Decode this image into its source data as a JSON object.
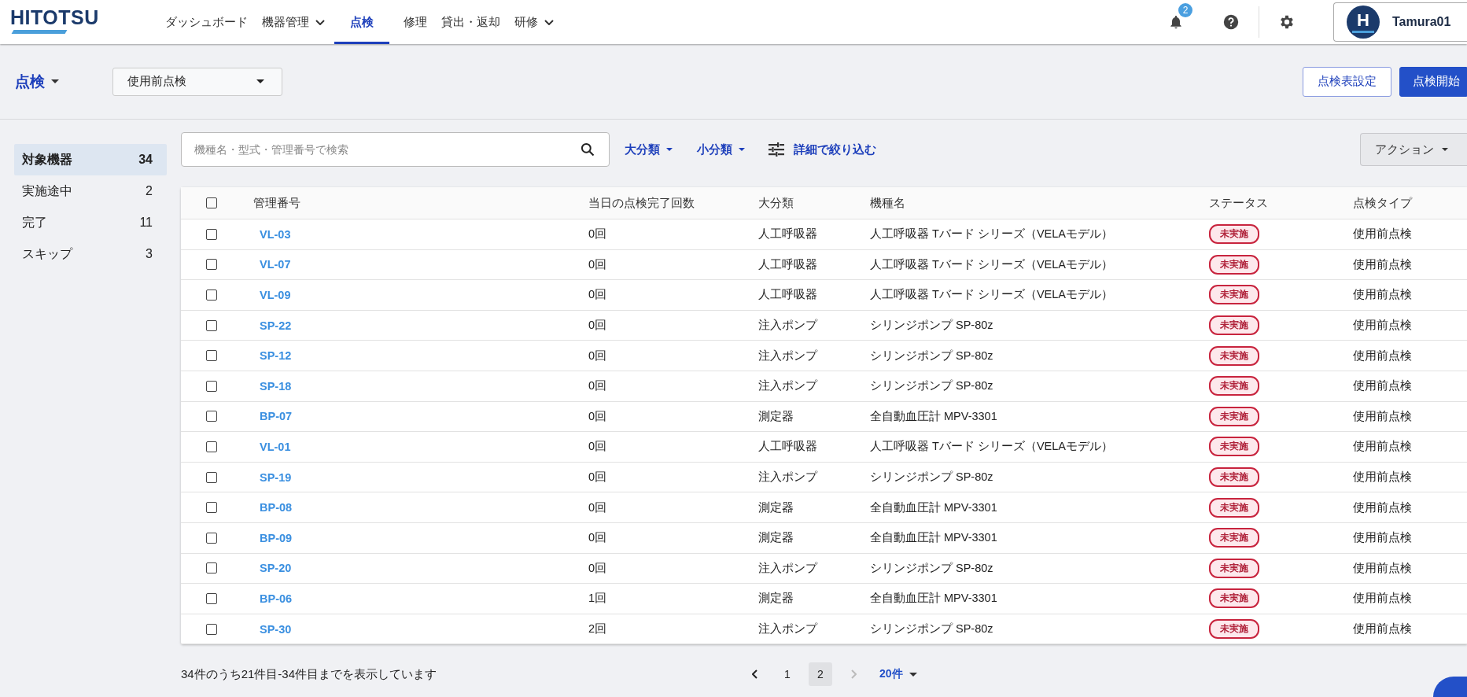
{
  "header": {
    "logo": "HITOTSU",
    "nav": [
      {
        "label": "ダッシュボード",
        "selected": false,
        "dropdown": false
      },
      {
        "label": "機器管理",
        "selected": false,
        "dropdown": true
      },
      {
        "label": "点検",
        "selected": true,
        "dropdown": false
      },
      {
        "label": "修理",
        "selected": false,
        "dropdown": false
      },
      {
        "label": "貸出・返却",
        "selected": false,
        "dropdown": false
      },
      {
        "label": "研修",
        "selected": false,
        "dropdown": true
      }
    ],
    "notification_count": "2",
    "user": {
      "avatar_letter": "H",
      "name": "Tamura01"
    }
  },
  "toolbar": {
    "title": "点検",
    "inspection_select": {
      "value": "使用前点検"
    },
    "buttons": [
      {
        "label": "点検表設定",
        "kind": "outline"
      },
      {
        "label": "点検開始",
        "kind": "primary"
      }
    ]
  },
  "sidebar": {
    "items": [
      {
        "label": "対象機器",
        "count": "34",
        "selected": true
      },
      {
        "label": "実施途中",
        "count": "2",
        "selected": false
      },
      {
        "label": "完了",
        "count": "11",
        "selected": false
      },
      {
        "label": "スキップ",
        "count": "3",
        "selected": false
      }
    ]
  },
  "filters": {
    "search": {
      "placeholder": "機種名・型式・管理番号で検索"
    },
    "dropdowns": [
      "大分類",
      "小分類"
    ],
    "detail_filter": "詳細で絞り込む",
    "action_button": "アクション"
  },
  "table": {
    "select_all_checked": false,
    "columns": [
      "管理番号",
      "当日の点検完了回数",
      "大分類",
      "機種名",
      "ステータス",
      "点検タイプ"
    ],
    "rows": [
      {
        "checked": false,
        "id": "VL-03",
        "count": "0回",
        "category": "人工呼吸器",
        "model": "人工呼吸器 Tバード シリーズ（VELAモデル）",
        "status": {
          "label": "未実施",
          "kind": "not_done"
        },
        "type": "使用前点検"
      },
      {
        "checked": false,
        "id": "VL-07",
        "count": "0回",
        "category": "人工呼吸器",
        "model": "人工呼吸器 Tバード シリーズ（VELAモデル）",
        "status": {
          "label": "未実施",
          "kind": "not_done"
        },
        "type": "使用前点検"
      },
      {
        "checked": false,
        "id": "VL-09",
        "count": "0回",
        "category": "人工呼吸器",
        "model": "人工呼吸器 Tバード シリーズ（VELAモデル）",
        "status": {
          "label": "未実施",
          "kind": "not_done"
        },
        "type": "使用前点検"
      },
      {
        "checked": false,
        "id": "SP-22",
        "count": "0回",
        "category": "注入ポンプ",
        "model": "シリンジポンプ SP-80z",
        "status": {
          "label": "未実施",
          "kind": "not_done"
        },
        "type": "使用前点検"
      },
      {
        "checked": false,
        "id": "SP-12",
        "count": "0回",
        "category": "注入ポンプ",
        "model": "シリンジポンプ SP-80z",
        "status": {
          "label": "未実施",
          "kind": "not_done"
        },
        "type": "使用前点検"
      },
      {
        "checked": false,
        "id": "SP-18",
        "count": "0回",
        "category": "注入ポンプ",
        "model": "シリンジポンプ SP-80z",
        "status": {
          "label": "未実施",
          "kind": "not_done"
        },
        "type": "使用前点検"
      },
      {
        "checked": false,
        "id": "BP-07",
        "count": "0回",
        "category": "測定器",
        "model": "全自動血圧計 MPV-3301",
        "status": {
          "label": "未実施",
          "kind": "not_done"
        },
        "type": "使用前点検"
      },
      {
        "checked": false,
        "id": "VL-01",
        "count": "0回",
        "category": "人工呼吸器",
        "model": "人工呼吸器 Tバード シリーズ（VELAモデル）",
        "status": {
          "label": "未実施",
          "kind": "not_done"
        },
        "type": "使用前点検"
      },
      {
        "checked": false,
        "id": "SP-19",
        "count": "0回",
        "category": "注入ポンプ",
        "model": "シリンジポンプ SP-80z",
        "status": {
          "label": "未実施",
          "kind": "not_done"
        },
        "type": "使用前点検"
      },
      {
        "checked": false,
        "id": "BP-08",
        "count": "0回",
        "category": "測定器",
        "model": "全自動血圧計 MPV-3301",
        "status": {
          "label": "未実施",
          "kind": "not_done"
        },
        "type": "使用前点検"
      },
      {
        "checked": false,
        "id": "BP-09",
        "count": "0回",
        "category": "測定器",
        "model": "全自動血圧計 MPV-3301",
        "status": {
          "label": "未実施",
          "kind": "not_done"
        },
        "type": "使用前点検"
      },
      {
        "checked": false,
        "id": "SP-20",
        "count": "0回",
        "category": "注入ポンプ",
        "model": "シリンジポンプ SP-80z",
        "status": {
          "label": "未実施",
          "kind": "not_done"
        },
        "type": "使用前点検"
      },
      {
        "checked": false,
        "id": "BP-06",
        "count": "1回",
        "category": "測定器",
        "model": "全自動血圧計 MPV-3301",
        "status": {
          "label": "未実施",
          "kind": "not_done"
        },
        "type": "使用前点検"
      },
      {
        "checked": false,
        "id": "SP-30",
        "count": "2回",
        "category": "注入ポンプ",
        "model": "シリンジポンプ SP-80z",
        "status": {
          "label": "未実施",
          "kind": "not_done"
        },
        "type": "使用前点検"
      }
    ]
  },
  "footer": {
    "summary": "34件のうち21件目-34件目までを表示しています",
    "pages": [
      {
        "label": "1",
        "selected": false
      },
      {
        "label": "2",
        "selected": true
      }
    ],
    "prev_disabled": false,
    "next_disabled": true,
    "page_size": "20件"
  }
}
